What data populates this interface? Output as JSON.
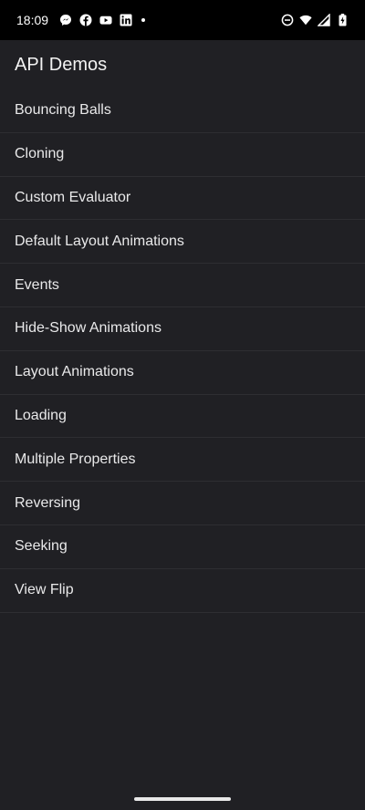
{
  "status_bar": {
    "time": "18:09",
    "left_icons": [
      "messenger-icon",
      "facebook-icon",
      "youtube-icon",
      "linkedin-icon",
      "notification-dot-icon"
    ],
    "right_icons": [
      "do-not-disturb-icon",
      "wifi-icon",
      "signal-icon",
      "battery-charging-icon"
    ]
  },
  "app_bar": {
    "title": "API Demos"
  },
  "list": {
    "items": [
      {
        "label": "Bouncing Balls"
      },
      {
        "label": "Cloning"
      },
      {
        "label": "Custom Evaluator"
      },
      {
        "label": "Default Layout Animations"
      },
      {
        "label": "Events"
      },
      {
        "label": "Hide-Show Animations"
      },
      {
        "label": "Layout Animations"
      },
      {
        "label": "Loading"
      },
      {
        "label": "Multiple Properties"
      },
      {
        "label": "Reversing"
      },
      {
        "label": "Seeking"
      },
      {
        "label": "View Flip"
      }
    ]
  },
  "colors": {
    "background": "#202024",
    "status_bar": "#000000",
    "divider": "#2e2e32",
    "text": "#e9e9ea"
  }
}
